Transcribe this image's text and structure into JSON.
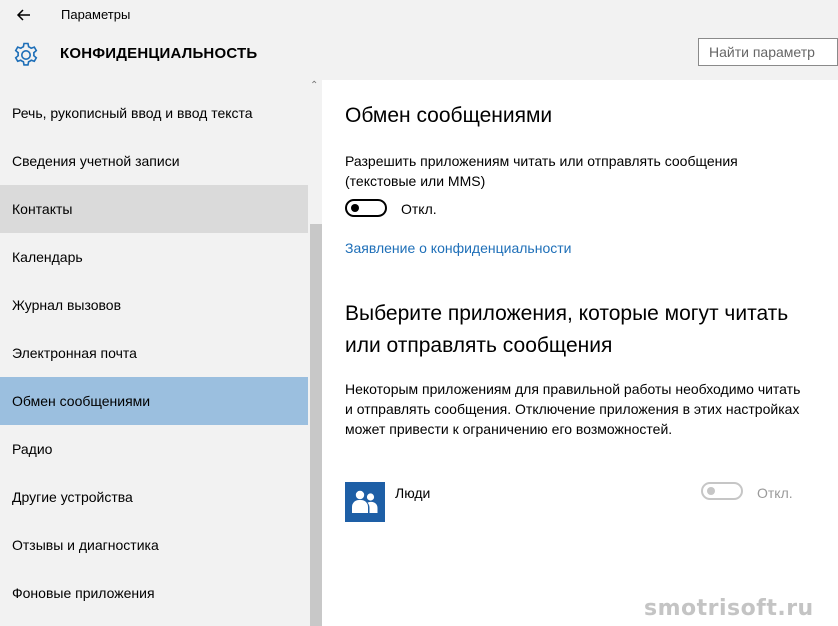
{
  "window": {
    "title": "Параметры"
  },
  "header": {
    "title": "КОНФИДЕНЦИАЛЬНОСТЬ",
    "search_placeholder": "Найти параметр"
  },
  "sidebar": {
    "items": [
      {
        "label": "Речь, рукописный ввод и ввод текста"
      },
      {
        "label": "Сведения учетной записи"
      },
      {
        "label": "Контакты"
      },
      {
        "label": "Календарь"
      },
      {
        "label": "Журнал вызовов"
      },
      {
        "label": "Электронная почта"
      },
      {
        "label": "Обмен сообщениями"
      },
      {
        "label": "Радио"
      },
      {
        "label": "Другие устройства"
      },
      {
        "label": "Отзывы и диагностика"
      },
      {
        "label": "Фоновые приложения"
      }
    ],
    "hovered": "Контакты",
    "selected": "Обмен сообщениями"
  },
  "main": {
    "heading": "Обмен сообщениями",
    "allow_description": "Разрешить приложениям читать или отправлять сообщения (текстовые или MMS)",
    "allow_toggle_label": "Откл.",
    "privacy_link": "Заявление о конфиденциальности",
    "choose_heading": "Выберите приложения, которые могут читать или отправлять сообщения",
    "choose_description": "Некоторым приложениям для правильной работы необходимо читать и отправлять сообщения. Отключение приложения в этих настройках может привести к ограничению его возможностей.",
    "apps": [
      {
        "name": "Люди",
        "toggle_label": "Откл.",
        "icon": "people-icon"
      }
    ]
  },
  "watermark": "smotrisoft.ru",
  "colors": {
    "accent": "#1e6fb8",
    "selected_bg": "#9bbfdf",
    "sidebar_bg": "#f2f2f2",
    "app_tile": "#1e5fa6"
  }
}
